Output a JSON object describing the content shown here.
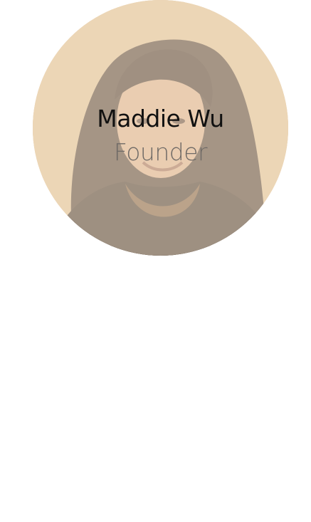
{
  "profile": {
    "name": "Maddie Wu",
    "role": "Founder"
  },
  "colors": {
    "overlay": "#f0e0c8",
    "name_text": "#111111",
    "role_text": "#6f6a66"
  },
  "icons": {
    "photo": "person-portrait"
  }
}
